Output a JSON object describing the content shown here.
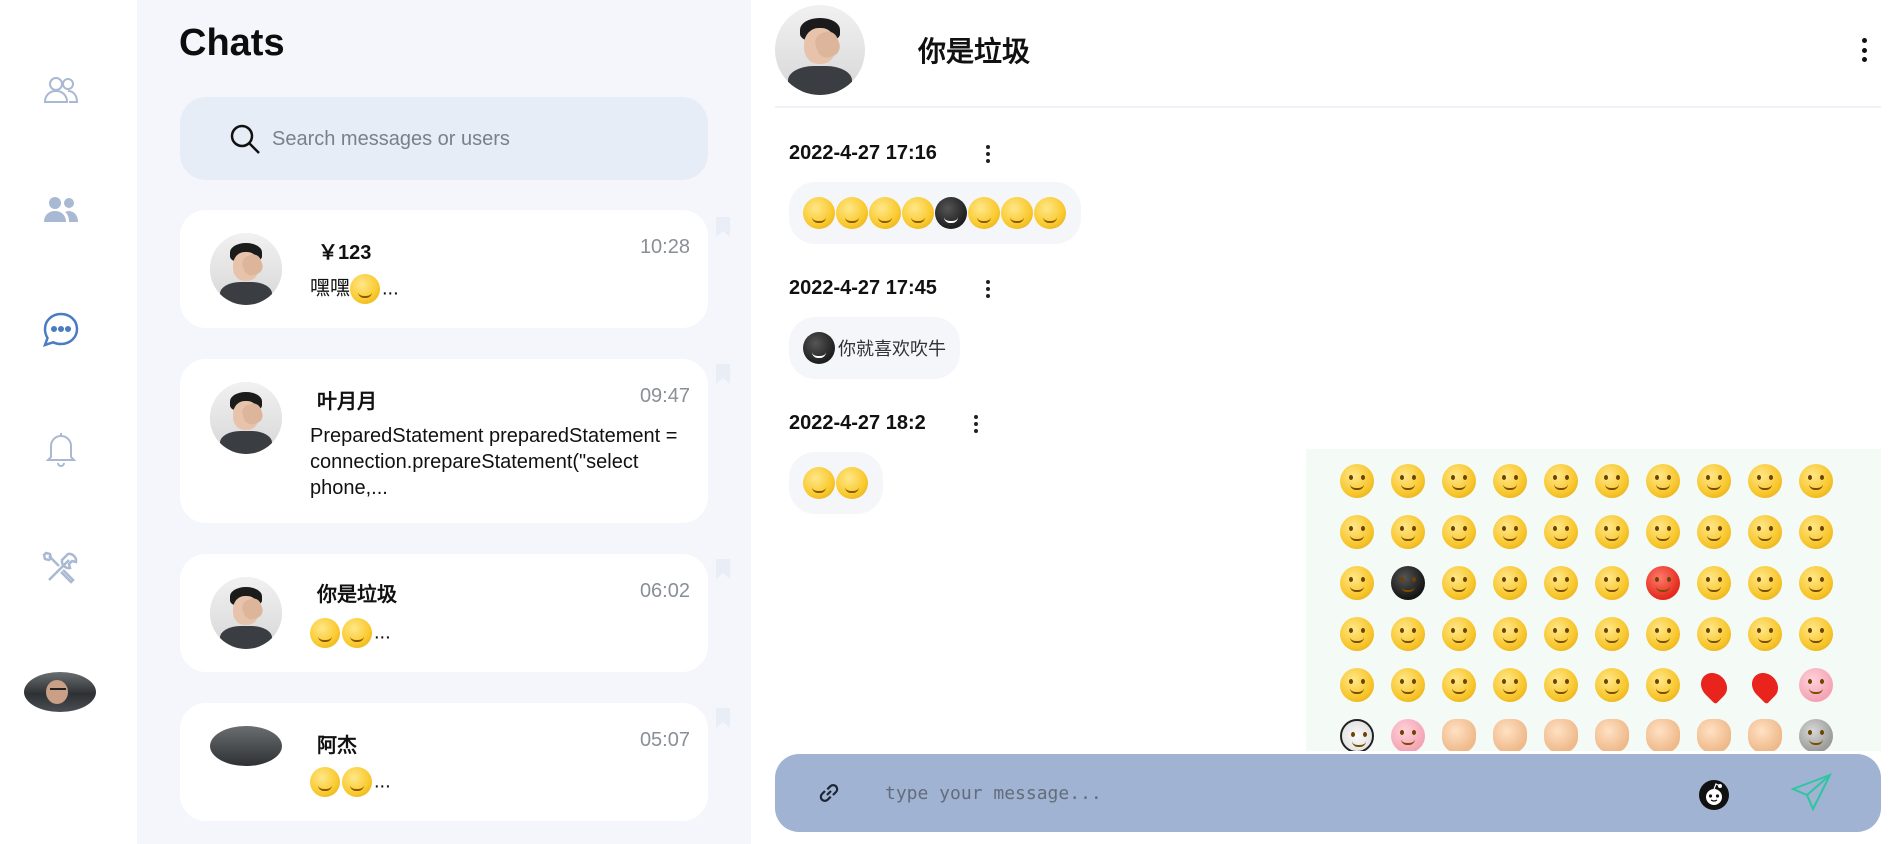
{
  "chat_list": {
    "title": "Chats",
    "search": {
      "placeholder": "Search messages or users"
    },
    "items": [
      {
        "name": "￥123",
        "time": "10:28",
        "preview": "嘿嘿",
        "preview_suffix": "..."
      },
      {
        "name": "叶月月",
        "time": "09:47",
        "preview": "PreparedStatement preparedStatement = connection.prepareStatement(\"select phone,..."
      },
      {
        "name": "你是垃圾",
        "time": "06:02",
        "preview_suffix": "..."
      },
      {
        "name": "阿杰",
        "time": "05:07",
        "preview_suffix": "..."
      }
    ]
  },
  "conversation": {
    "title": "你是垃圾",
    "messages": [
      {
        "time": "2022-4-27 17:16",
        "emoji_count": 8
      },
      {
        "time": "2022-4-27 17:45",
        "text": "你就喜欢吹牛"
      },
      {
        "time": "2022-4-27 18:2",
        "emoji_count": 2
      }
    ],
    "input": {
      "placeholder": "type your message..."
    }
  },
  "colors": {
    "accent": "#4a7cc4",
    "rail_icon": "#a9b8d3",
    "list_bg": "#f4f6fb",
    "input_bar": "#a0b3d3",
    "picker_bg": "#f4fbf7"
  },
  "icons": {
    "rail": [
      "contacts-icon",
      "groups-icon",
      "chat-icon",
      "bell-icon",
      "tools-icon"
    ],
    "input": [
      "link-icon",
      "emoji-icon",
      "send-icon"
    ]
  }
}
